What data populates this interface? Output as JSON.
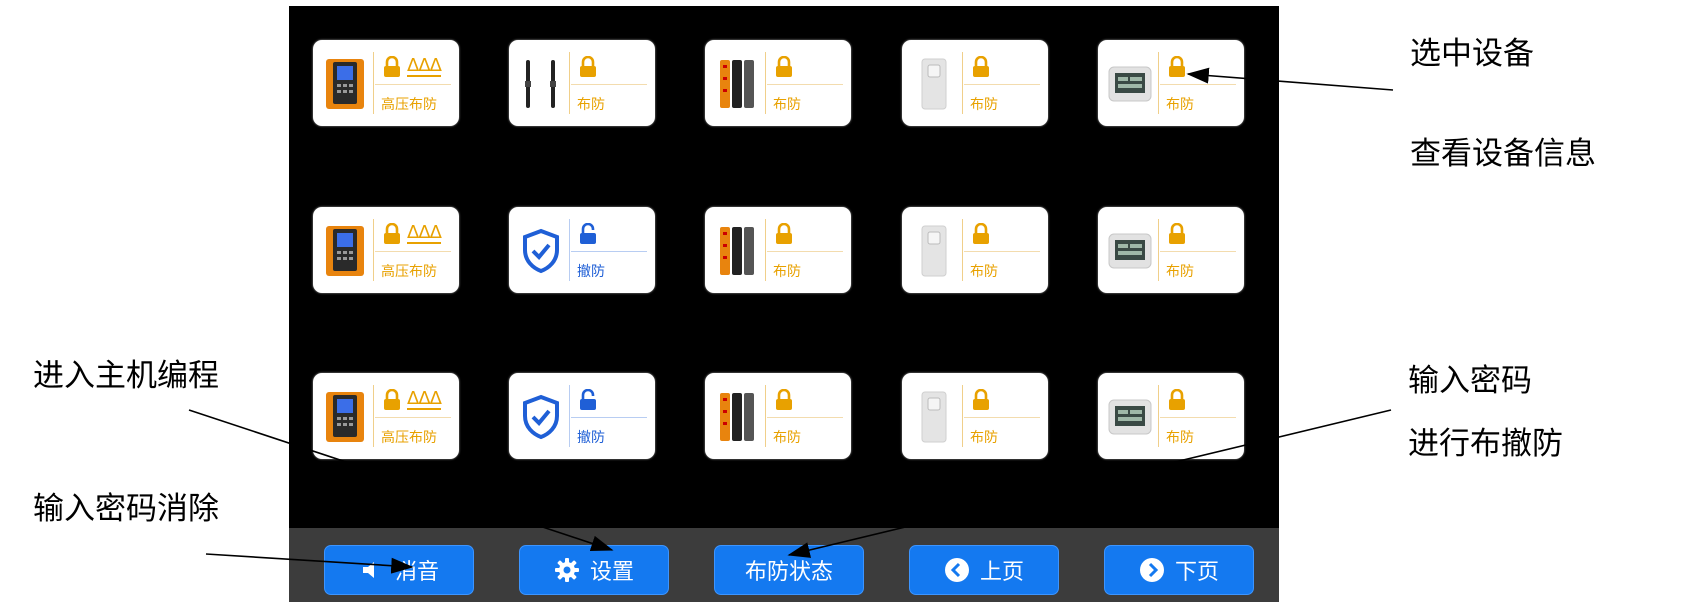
{
  "annotations": {
    "select_device": "选中设备",
    "view_info": "查看设备信息",
    "enter_programming": "进入主机编程",
    "password_clear": "输入密码消除",
    "enter_password": "输入密码",
    "arm_disarm": "进行布撤防"
  },
  "grid": {
    "rows": [
      [
        {
          "device": "keypad-panel",
          "state": "高压布防",
          "lock": "locked",
          "triangles": "ΔΔΔ",
          "color": "#e8a100"
        },
        {
          "device": "beam-detector",
          "state": "布防",
          "lock": "locked",
          "color": "#e8a100"
        },
        {
          "device": "fence-detector",
          "state": "布防",
          "lock": "locked",
          "color": "#e8a100"
        },
        {
          "device": "pir-sensor",
          "state": "布防",
          "lock": "locked",
          "color": "#e8a100"
        },
        {
          "device": "thermometer-display",
          "state": "布防",
          "lock": "locked",
          "color": "#e8a100"
        }
      ],
      [
        {
          "device": "keypad-panel",
          "state": "高压布防",
          "lock": "locked",
          "triangles": "ΔΔΔ",
          "color": "#e8a100"
        },
        {
          "device": "shield-check",
          "state": "撤防",
          "lock": "unlocked",
          "color": "#1f5fd6"
        },
        {
          "device": "fence-detector",
          "state": "布防",
          "lock": "locked",
          "color": "#e8a100"
        },
        {
          "device": "pir-sensor",
          "state": "布防",
          "lock": "locked",
          "color": "#e8a100"
        },
        {
          "device": "thermometer-display",
          "state": "布防",
          "lock": "locked",
          "color": "#e8a100"
        }
      ],
      [
        {
          "device": "keypad-panel",
          "state": "高压布防",
          "lock": "locked",
          "triangles": "ΔΔΔ",
          "color": "#e8a100"
        },
        {
          "device": "shield-check",
          "state": "撤防",
          "lock": "unlocked",
          "color": "#1f5fd6"
        },
        {
          "device": "fence-detector",
          "state": "布防",
          "lock": "locked",
          "color": "#e8a100"
        },
        {
          "device": "pir-sensor",
          "state": "布防",
          "lock": "locked",
          "color": "#e8a100"
        },
        {
          "device": "thermometer-display",
          "state": "布防",
          "lock": "locked",
          "color": "#e8a100"
        }
      ]
    ]
  },
  "toolbar": {
    "mute": {
      "label": "消音",
      "icon": "speaker-icon"
    },
    "settings": {
      "label": "设置",
      "icon": "gear-icon"
    },
    "arm_status": {
      "label": "布防状态"
    },
    "prev": {
      "label": "上页",
      "icon": "chevron-left-icon"
    },
    "next": {
      "label": "下页",
      "icon": "chevron-right-icon"
    }
  },
  "colors": {
    "armed": "#e8a100",
    "disarmed": "#1f5fd6",
    "button": "#1479f0",
    "toolbar_bg": "#3c3c3c",
    "screen_bg": "#000000"
  }
}
